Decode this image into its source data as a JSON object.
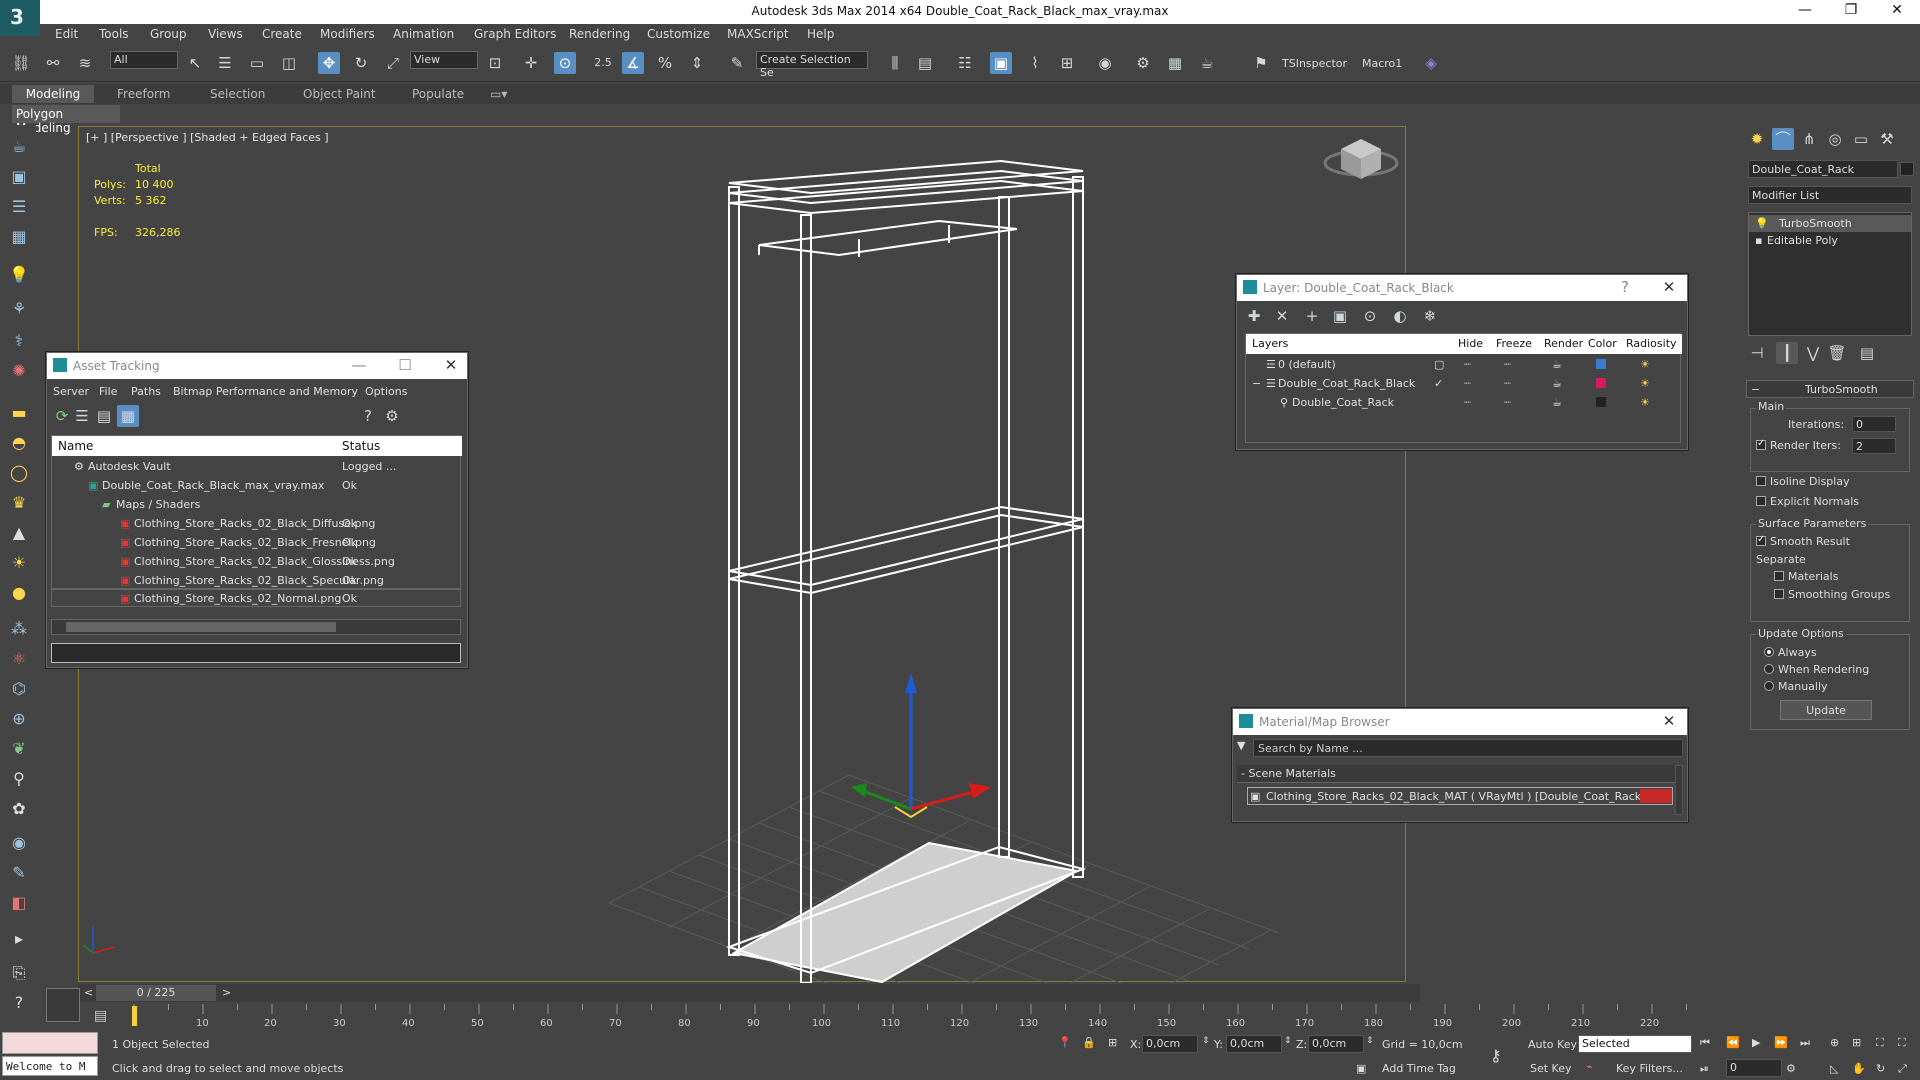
{
  "window": {
    "title": "Autodesk 3ds Max  2014 x64     Double_Coat_Rack_Black_max_vray.max",
    "logo": "3"
  },
  "menu": [
    "Edit",
    "Tools",
    "Group",
    "Views",
    "Create",
    "Modifiers",
    "Animation",
    "Graph Editors",
    "Rendering",
    "Customize",
    "MAXScript",
    "Help"
  ],
  "toolbar": {
    "filter_value": "All",
    "refcoord_value": "View",
    "snap_value": "2.5",
    "selection_set_placeholder": "Create Selection Se",
    "tsinspector_label": "TSInspector",
    "macro_label": "Macro1"
  },
  "ribbon": {
    "tabs": [
      "Modeling",
      "Freeform",
      "Selection",
      "Object Paint",
      "Populate"
    ],
    "sub_label": "Polygon Modeling"
  },
  "viewport": {
    "label": "[+ ] [Perspective ] [Shaded + Edged Faces ]",
    "stats": {
      "total_label": "Total",
      "polys_label": "Polys:",
      "polys_value": "10 400",
      "verts_label": "Verts:",
      "verts_value": "5 362",
      "fps_label": "FPS:",
      "fps_value": "326,286"
    }
  },
  "asset_tracking": {
    "title": "Asset Tracking",
    "menu": [
      "Server",
      "File",
      "Paths",
      "Bitmap Performance and Memory",
      "Options"
    ],
    "col_name": "Name",
    "col_status": "Status",
    "rows": [
      {
        "name": "Autodesk Vault",
        "status": "Logged ..."
      },
      {
        "name": "Double_Coat_Rack_Black_max_vray.max",
        "status": "Ok"
      },
      {
        "name": "Maps / Shaders",
        "status": ""
      },
      {
        "name": "Clothing_Store_Racks_02_Black_Diffuse.png",
        "status": "Ok"
      },
      {
        "name": "Clothing_Store_Racks_02_Black_Fresnel.png",
        "status": "Ok"
      },
      {
        "name": "Clothing_Store_Racks_02_Black_Glossiness.png",
        "status": "Ok"
      },
      {
        "name": "Clothing_Store_Racks_02_Black_Specular.png",
        "status": "Ok"
      },
      {
        "name": "Clothing_Store_Racks_02_Normal.png",
        "status": "Ok"
      }
    ]
  },
  "layer_window": {
    "title": "Layer: Double_Coat_Rack_Black",
    "help": "?",
    "columns": [
      "Layers",
      "Hide",
      "Freeze",
      "Render",
      "Color",
      "Radiosity"
    ],
    "rows": [
      {
        "name": "0 (default)",
        "color": "#3a7bd5"
      },
      {
        "name": "Double_Coat_Rack_Black",
        "color": "#d81b60"
      },
      {
        "name": "Double_Coat_Rack",
        "color": "#222222"
      }
    ]
  },
  "material_browser": {
    "title": "Material/Map Browser",
    "search_placeholder": "Search by Name ...",
    "section": "- Scene Materials",
    "item": "Clothing_Store_Racks_02_Black_MAT ( VRayMtl ) [Double_Coat_Rack]"
  },
  "command_panel": {
    "object_name": "Double_Coat_Rack",
    "modifier_list_label": "Modifier List",
    "stack": [
      "TurboSmooth",
      "Editable Poly"
    ],
    "rollout_title": "TurboSmooth",
    "main_label": "Main",
    "iterations_label": "Iterations:",
    "iterations_value": "0",
    "render_iters_label": "Render Iters:",
    "render_iters_value": "2",
    "isoline_label": "Isoline Display",
    "explicit_normals_label": "Explicit Normals",
    "surface_params_label": "Surface Parameters",
    "smooth_result_label": "Smooth Result",
    "separate_label": "Separate",
    "materials_label": "Materials",
    "smoothing_groups_label": "Smoothing Groups",
    "update_options_label": "Update Options",
    "always_label": "Always",
    "when_rendering_label": "When Rendering",
    "manually_label": "Manually",
    "update_button": "Update"
  },
  "timeline": {
    "frame_label": "0 / 225",
    "ticks": [
      "10",
      "20",
      "30",
      "40",
      "50",
      "60",
      "70",
      "80",
      "90",
      "100",
      "110",
      "120",
      "130",
      "140",
      "150",
      "160",
      "170",
      "180",
      "190",
      "200",
      "210",
      "220"
    ]
  },
  "status": {
    "script_listener": "Welcome to M",
    "selection_info": "1 Object Selected",
    "prompt": "Click and drag to select and move objects",
    "x_label": "X:",
    "x_value": "0,0cm",
    "y_label": "Y:",
    "y_value": "0,0cm",
    "z_label": "Z:",
    "z_value": "0,0cm",
    "grid": "Grid = 10,0cm",
    "add_time_tag": "Add Time Tag",
    "auto_key": "Auto Key",
    "set_key": "Set Key",
    "selected_value": "Selected",
    "key_filters": "Key Filters...",
    "frame_value": "0"
  }
}
